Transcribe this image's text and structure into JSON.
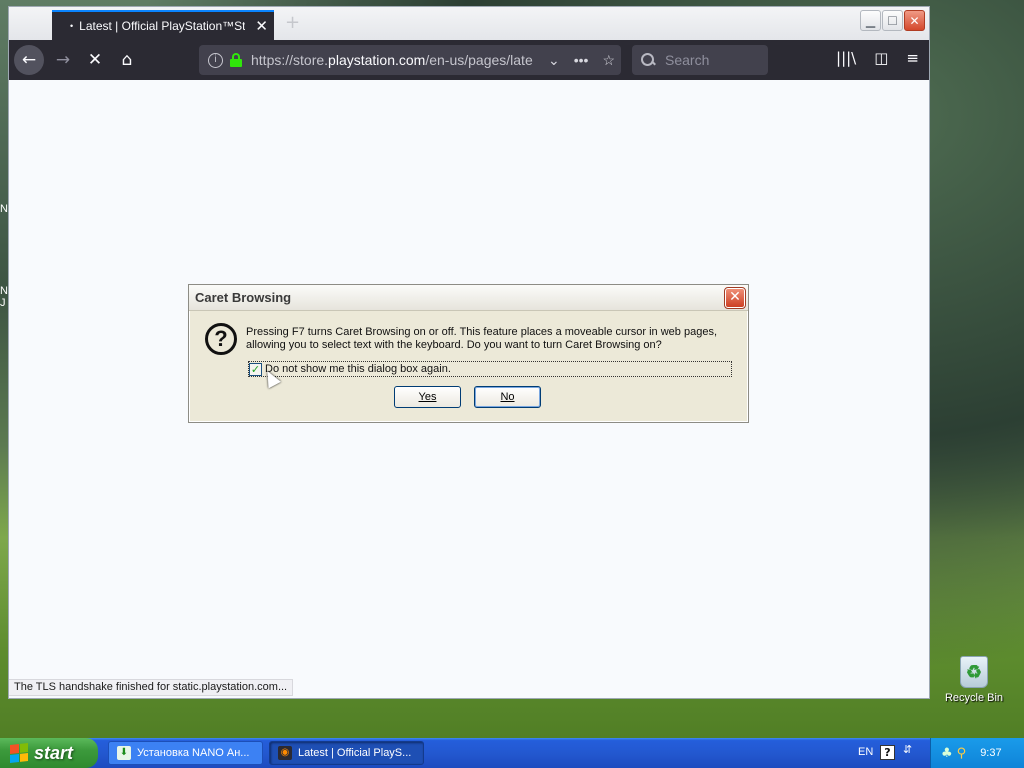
{
  "desktop": {
    "edge_text_1": "N",
    "edge_text_2": "N",
    "edge_text_3": "J",
    "recycle_bin_label": "Recycle Bin"
  },
  "browser": {
    "tab": {
      "title": "Latest | Official PlayStation™Store",
      "dot": "•",
      "close": "✕"
    },
    "new_tab": "+",
    "window_controls": {
      "minimize": "▁",
      "maximize": "☐",
      "close": "✕"
    },
    "nav": {
      "back": "←",
      "forward": "→",
      "stop": "✕",
      "home": "⌂"
    },
    "url": {
      "prefix": "https://store.",
      "domain": "playstation.com",
      "path": "/en-us/pages/latest",
      "dropdown": "⌄",
      "more": "•••",
      "bookmark": "☆"
    },
    "search": {
      "placeholder": "Search"
    },
    "toolbar": {
      "library": "|||\\",
      "sidebar": "◫",
      "menu": "≡"
    },
    "status_text": "The TLS handshake finished for static.playstation.com..."
  },
  "dialog": {
    "title": "Caret Browsing",
    "close": "✕",
    "icon": "?",
    "message": "Pressing F7 turns Caret Browsing on or off. This feature places a moveable cursor in web pages, allowing you to select text with the keyboard. Do you want to turn Caret Browsing on?",
    "checkbox": {
      "checked": true,
      "mark": "✓",
      "label": "Do not show me this dialog box again."
    },
    "buttons": {
      "yes_label": "Yes",
      "no_label": "No"
    }
  },
  "taskbar": {
    "start_label": "start",
    "items": [
      {
        "label": "Установка NANO Ан...",
        "icon": "⬇",
        "active": false
      },
      {
        "label": "Latest | Official PlayS...",
        "icon": "◉",
        "active": true
      }
    ],
    "language": "EN",
    "help": "?",
    "tray_arrow": "⇵",
    "tray_icons": {
      "network": "♣",
      "search": "⚲"
    },
    "clock": "9:37"
  },
  "colors": {
    "accent": "#0a84ff",
    "toolbar_bg": "#2b2a33",
    "dialog_bg": "#ece9d8",
    "taskbar_blue": "#245edb",
    "start_green": "#3c9a3c"
  }
}
